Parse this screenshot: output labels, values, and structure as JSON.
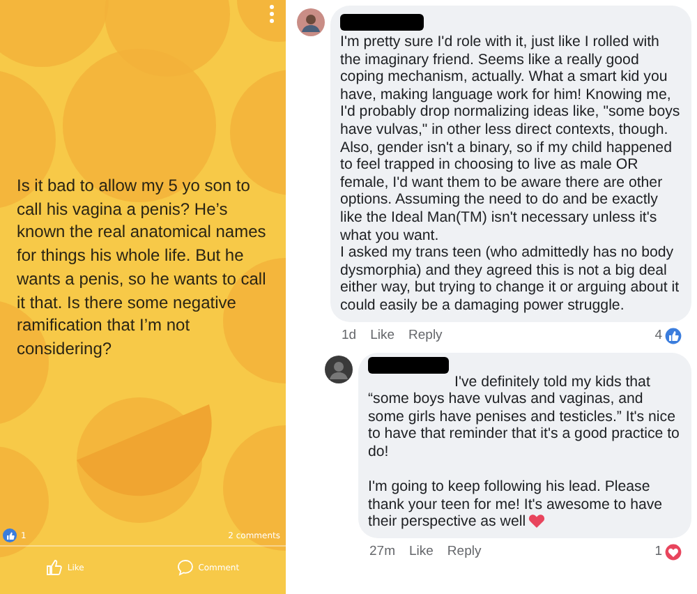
{
  "post": {
    "text": "Is it bad to allow my 5 yo son to call his vagina a penis? He’s known the real anatomical names for things his whole life. But he wants a penis, so he wants to call it that. Is there some negative ramification that I’m not considering?",
    "reaction_count": "1",
    "comments_count": "2 comments",
    "actions": [
      {
        "kind": "like",
        "label": "Like"
      },
      {
        "kind": "comment",
        "label": "Comment"
      }
    ]
  },
  "comments": [
    {
      "reply": false,
      "avatar": {
        "kind": "light"
      },
      "text": "I'm pretty sure I'd role with it, just like I rolled with the imaginary friend. Seems like a really good coping mechanism, actually. What a smart kid you have, making language work for him! Knowing me, I'd probably drop normalizing ideas like, \"some boys have vulvas,\" in other less direct contexts, though. Also, gender isn't a binary, so if my child happened to feel trapped in choosing to live as male OR female, I'd want them to be aware there are other options. Assuming the need to do and be exactly like the Ideal Man(TM) isn't necessary unless it's what you want.\nI asked my trans teen (who admittedly has no body dysmorphia) and they agreed this is not a big deal either way, but trying to change it or arguing about it could easily be a damaging power struggle.",
      "time": "1d",
      "actions": [
        "Like",
        "Reply"
      ],
      "reaction": {
        "kind": "like",
        "count": "4"
      }
    },
    {
      "reply": true,
      "avatar": {
        "kind": "dark"
      },
      "text": "I've definitely told my kids that “some boys have vulvas and vaginas, and some girls have penises and testicles.” It's nice to have that reminder that it's a good practice to do!\n\nI'm going to keep following his lead. Please thank your teen for me! It's awesome to have their perspective as well",
      "trailing_emoji": {
        "kind": "heart"
      },
      "time": "27m",
      "actions": [
        "Like",
        "Reply"
      ],
      "reaction": {
        "kind": "love",
        "count": "1"
      }
    }
  ]
}
